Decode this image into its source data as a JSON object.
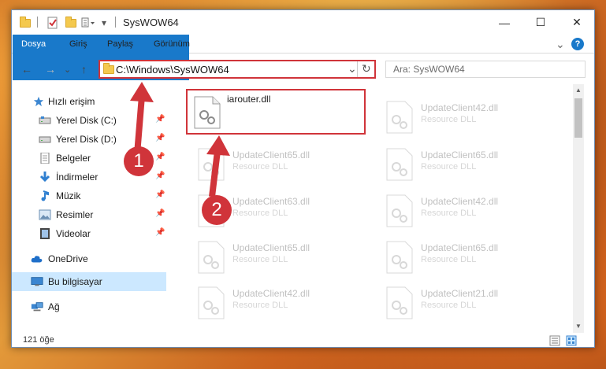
{
  "window": {
    "title": "SysWOW64"
  },
  "titlebar": {
    "quick_access_dropdown": "▾",
    "minimize": "—",
    "maximize": "☐",
    "close": "✕"
  },
  "ribbon": {
    "tabs": [
      "Dosya",
      "Giriş",
      "Paylaş",
      "Görünüm"
    ],
    "expand_chevron": "⌄",
    "help": "?"
  },
  "address": {
    "path": "C:\\Windows\\SysWOW64",
    "dropdown": "⌄",
    "refresh": "↻"
  },
  "nav": {
    "back": "←",
    "forward": "→",
    "recent": "⌄",
    "up": "↑"
  },
  "search": {
    "placeholder": "Ara: SysWOW64"
  },
  "sidebar": {
    "items": [
      {
        "label": "Hızlı erişim",
        "icon": "star-icon"
      },
      {
        "label": "Yerel Disk (C:)",
        "icon": "drive-icon",
        "pinned": true
      },
      {
        "label": "Yerel Disk (D:)",
        "icon": "drive-icon",
        "pinned": true
      },
      {
        "label": "Belgeler",
        "icon": "documents-icon",
        "pinned": true
      },
      {
        "label": "İndirmeler",
        "icon": "download-icon",
        "pinned": true
      },
      {
        "label": "Müzik",
        "icon": "music-icon",
        "pinned": true
      },
      {
        "label": "Resimler",
        "icon": "pictures-icon",
        "pinned": true
      },
      {
        "label": "Videolar",
        "icon": "videos-icon",
        "pinned": true
      },
      {
        "label": "OneDrive",
        "icon": "cloud-icon"
      },
      {
        "label": "Bu bilgisayar",
        "icon": "computer-icon",
        "selected": true
      },
      {
        "label": "Ağ",
        "icon": "network-icon"
      }
    ]
  },
  "files": [
    {
      "name": "iarouter.dll",
      "type": "",
      "highlighted": true
    },
    {
      "name": "UpdateClient42.dll",
      "type": "Resource DLL"
    },
    {
      "name": "UpdateClient65.dll",
      "type": "Resource DLL"
    },
    {
      "name": "UpdateClient65.dll",
      "type": "Resource DLL"
    },
    {
      "name": "UpdateClient63.dll",
      "type": "Resource DLL"
    },
    {
      "name": "UpdateClient42.dll",
      "type": "Resource DLL"
    },
    {
      "name": "UpdateClient65.dll",
      "type": "Resource DLL"
    },
    {
      "name": "UpdateClient65.dll",
      "type": "Resource DLL"
    },
    {
      "name": "UpdateClient42.dll",
      "type": "Resource DLL"
    },
    {
      "name": "UpdateClient21.dll",
      "type": "Resource DLL"
    }
  ],
  "status": {
    "item_count": "121 öğe"
  },
  "annotations": {
    "step1": "1",
    "step2": "2"
  },
  "colors": {
    "accent": "#1979ca",
    "annotation": "#d0343a",
    "selected_bg": "#cce8ff"
  }
}
